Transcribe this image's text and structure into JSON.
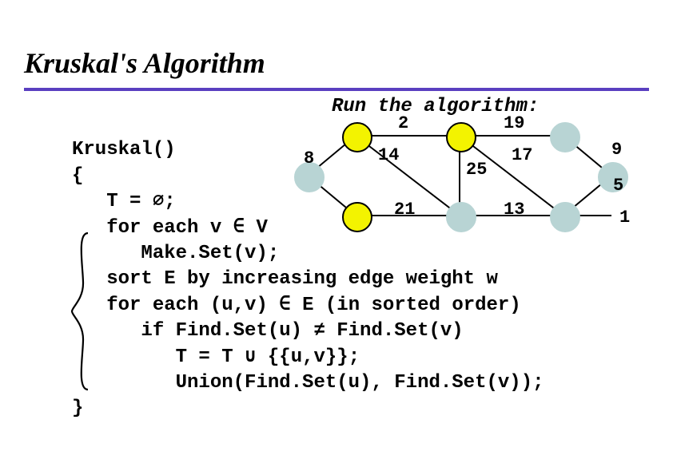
{
  "title": "Kruskal's Algorithm",
  "code": {
    "l1": "Kruskal()",
    "l2": "{",
    "l3": "   T = ∅;",
    "l4": "   for each v ∈ V",
    "l5": "      Make.Set(v);",
    "l6": "   sort E by increasing edge weight w",
    "l7": "   for each (u,v) ∈ E (in sorted order)",
    "l8": "      if Find.Set(u) ≠ Find.Set(v)",
    "l9": "         T = T ∪ {{u,v}};",
    "l10": "         Union(Find.Set(u), Find.Set(v));",
    "l11": "}"
  },
  "graph": {
    "run_label": "Run the algorithm:",
    "weights": {
      "w2": "2",
      "w19": "19",
      "w8": "8",
      "w14": "14",
      "w25": "25",
      "w17": "17",
      "w9": "9",
      "w5": "5",
      "w21": "21",
      "w13": "13",
      "w1": "1"
    },
    "nodes": {
      "A": "selected",
      "B": "selected",
      "C": "unselected",
      "D": "unselected",
      "E": "selected",
      "F": "unselected",
      "G": "unselected",
      "H": "unselected"
    }
  }
}
